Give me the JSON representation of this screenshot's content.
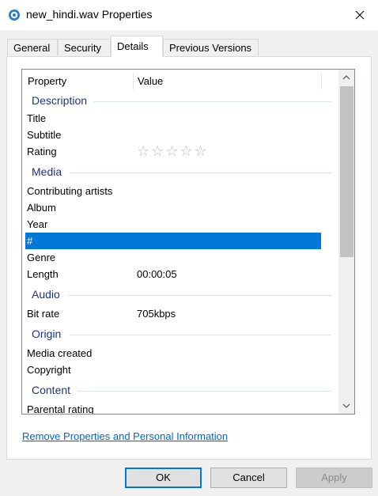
{
  "window": {
    "title": "new_hindi.wav Properties",
    "icon": "media-file-icon",
    "close_icon": "close-icon"
  },
  "tabs": [
    {
      "label": "General",
      "active": false
    },
    {
      "label": "Security",
      "active": false
    },
    {
      "label": "Details",
      "active": true
    },
    {
      "label": "Previous Versions",
      "active": false
    }
  ],
  "list": {
    "columns": {
      "property": "Property",
      "value": "Value"
    },
    "groups": {
      "description": "Description",
      "media": "Media",
      "audio": "Audio",
      "origin": "Origin",
      "content": "Content"
    },
    "rows": {
      "title": {
        "name": "Title",
        "value": ""
      },
      "subtitle": {
        "name": "Subtitle",
        "value": ""
      },
      "rating": {
        "name": "Rating",
        "stars": "☆☆☆☆☆",
        "rating_value": 0,
        "rating_max": 5
      },
      "contributing_artists": {
        "name": "Contributing artists",
        "value": ""
      },
      "album": {
        "name": "Album",
        "value": ""
      },
      "year": {
        "name": "Year",
        "value": ""
      },
      "number": {
        "name": "#",
        "value": "",
        "selected": true
      },
      "genre": {
        "name": "Genre",
        "value": ""
      },
      "length": {
        "name": "Length",
        "value": "00:00:05"
      },
      "bit_rate": {
        "name": "Bit rate",
        "value": "705kbps"
      },
      "media_created": {
        "name": "Media created",
        "value": ""
      },
      "copyright": {
        "name": "Copyright",
        "value": ""
      },
      "parental_rating": {
        "name": "Parental rating",
        "value": ""
      }
    }
  },
  "links": {
    "remove_properties": "Remove Properties and Personal Information"
  },
  "buttons": {
    "ok": "OK",
    "cancel": "Cancel",
    "apply": "Apply"
  },
  "colors": {
    "selection": "#0078d7",
    "group_header": "#1e3287",
    "link": "#0066cc"
  }
}
